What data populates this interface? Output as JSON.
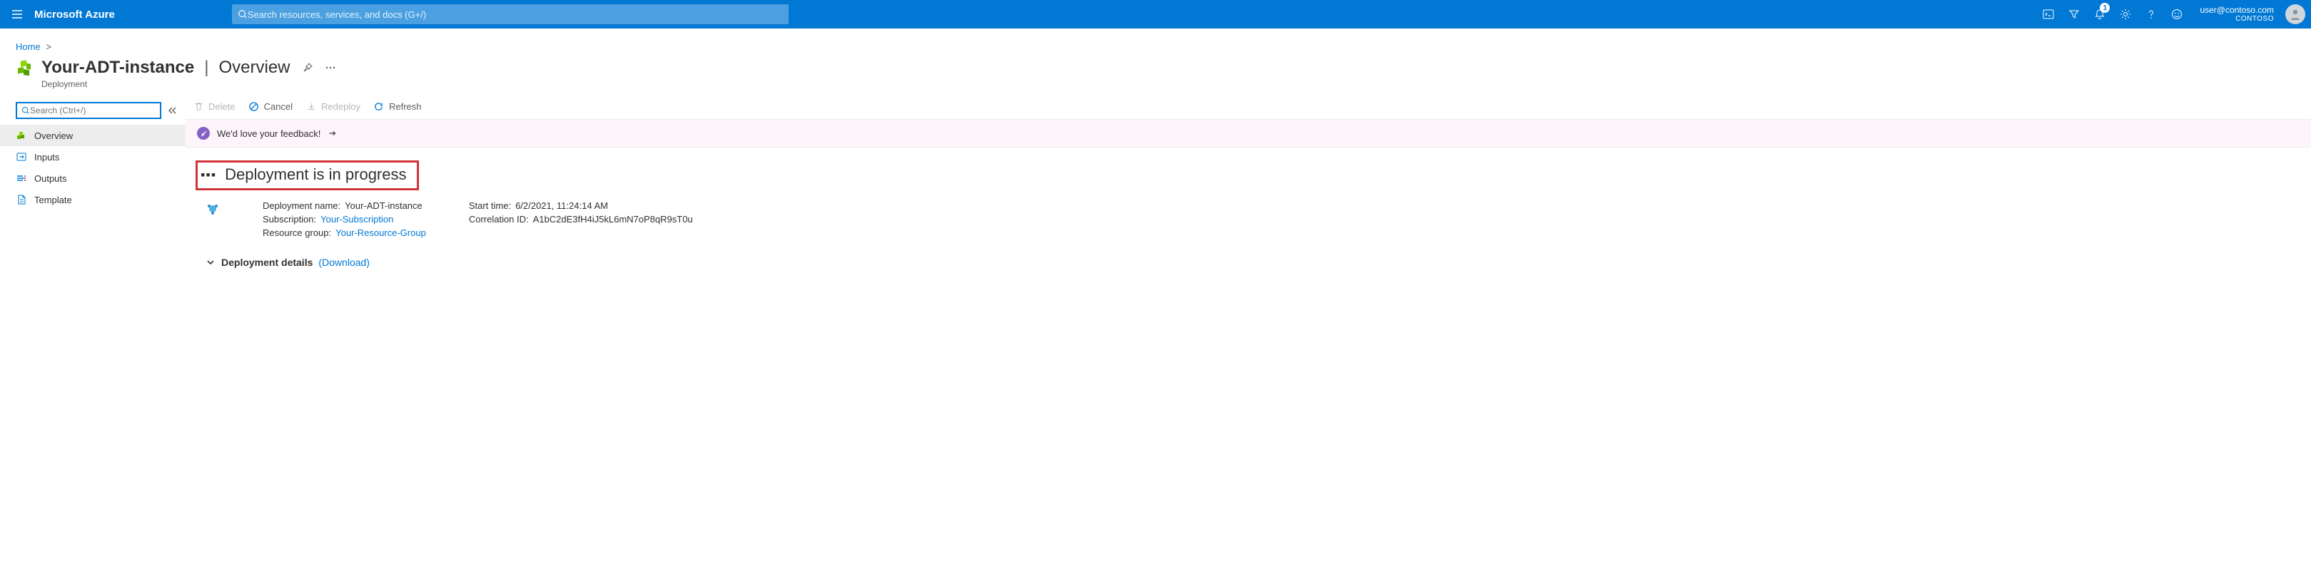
{
  "topbar": {
    "brand": "Microsoft Azure",
    "search_placeholder": "Search resources, services, and docs (G+/)",
    "notification_count": "1",
    "account_email": "user@contoso.com",
    "tenant": "CONTOSO"
  },
  "breadcrumb": {
    "home": "Home"
  },
  "header": {
    "resource_name": "Your-ADT-instance",
    "section": "Overview",
    "subtitle": "Deployment"
  },
  "sidebar": {
    "search_placeholder": "Search (Ctrl+/)",
    "items": [
      {
        "label": "Overview"
      },
      {
        "label": "Inputs"
      },
      {
        "label": "Outputs"
      },
      {
        "label": "Template"
      }
    ]
  },
  "toolbar": {
    "delete": "Delete",
    "cancel": "Cancel",
    "redeploy": "Redeploy",
    "refresh": "Refresh"
  },
  "feedback": {
    "text": "We'd love your feedback!"
  },
  "status": {
    "heading": "Deployment is in progress"
  },
  "meta": {
    "deployment_name_label": "Deployment name:",
    "deployment_name": "Your-ADT-instance",
    "subscription_label": "Subscription:",
    "subscription": "Your-Subscription",
    "resource_group_label": "Resource group:",
    "resource_group": "Your-Resource-Group",
    "start_time_label": "Start time:",
    "start_time": "6/2/2021, 11:24:14 AM",
    "correlation_label": "Correlation ID:",
    "correlation": "A1bC2dE3fH4iJ5kL6mN7oP8qR9sT0u"
  },
  "details": {
    "label": "Deployment details",
    "download": "(Download)"
  }
}
